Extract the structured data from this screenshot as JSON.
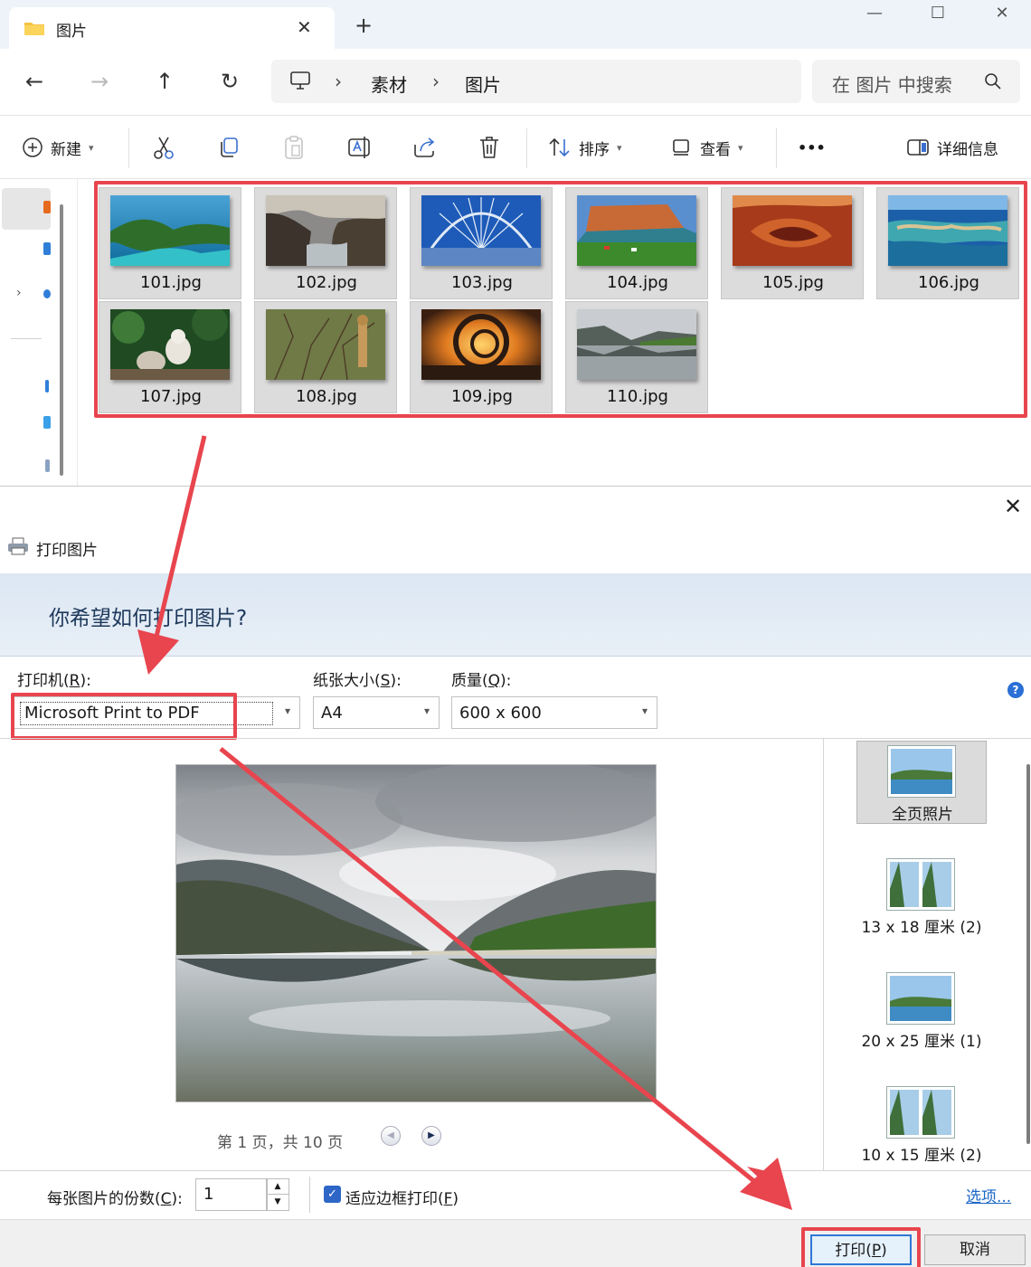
{
  "explorer": {
    "tab_title": "图片",
    "breadcrumb": [
      "素材",
      "图片"
    ],
    "search_placeholder": "在 图片 中搜索",
    "toolbar": {
      "new_label": "新建",
      "sort_label": "排序",
      "view_label": "查看",
      "more_label": "•••",
      "details_label": "详细信息"
    },
    "files": [
      {
        "name": "101.jpg"
      },
      {
        "name": "102.jpg"
      },
      {
        "name": "103.jpg"
      },
      {
        "name": "104.jpg"
      },
      {
        "name": "105.jpg"
      },
      {
        "name": "106.jpg"
      },
      {
        "name": "107.jpg"
      },
      {
        "name": "108.jpg"
      },
      {
        "name": "109.jpg"
      },
      {
        "name": "110.jpg"
      }
    ]
  },
  "print_dialog": {
    "title": "打印图片",
    "question": "你希望如何打印图片?",
    "printer_label": "打印机(R):",
    "printer_label_pre": "打印机(",
    "printer_label_key": "R",
    "printer_label_post": "):",
    "printer_value": "Microsoft Print to PDF",
    "paper_label_pre": "纸张大小(",
    "paper_label_key": "S",
    "paper_label_post": "):",
    "paper_value": "A4",
    "quality_label_pre": "质量(",
    "quality_label_key": "Q",
    "quality_label_post": "):",
    "quality_value": "600 x 600",
    "help_icon": "?",
    "pager_text": "第 1 页，共 10 页",
    "layouts": [
      {
        "label": "全页照片",
        "selected": true
      },
      {
        "label": "13 x 18 厘米 (2)",
        "selected": false
      },
      {
        "label": "20 x 25 厘米 (1)",
        "selected": false
      },
      {
        "label": "10 x 15 厘米 (2)",
        "selected": false
      }
    ],
    "copies_label_pre": "每张图片的份数(",
    "copies_label_key": "C",
    "copies_label_post": "):",
    "copies_value": "1",
    "fit_label_pre": "适应边框打印(",
    "fit_label_key": "F",
    "fit_label_post": ")",
    "fit_checked": true,
    "options_link": "选项...",
    "print_button_pre": "打印(",
    "print_button_key": "P",
    "print_button_post": ")",
    "cancel_button": "取消"
  },
  "colors": {
    "highlight": "#e8454e",
    "accent": "#2d66c6"
  }
}
